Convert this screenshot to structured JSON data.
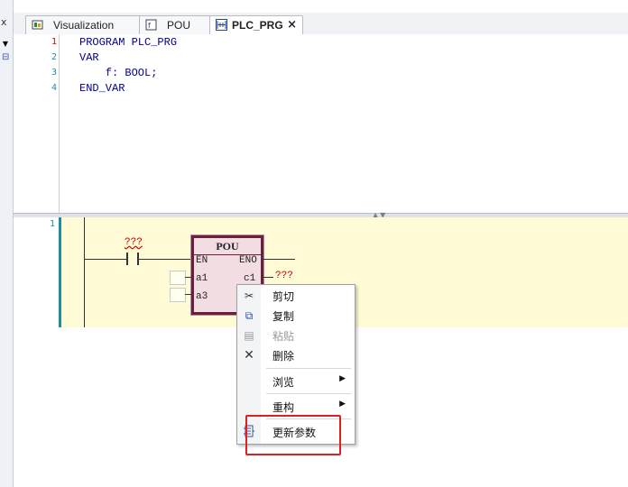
{
  "left_strip": {
    "close_glyph": "x",
    "dropdown_glyph": "▼"
  },
  "tabs": [
    {
      "label": "Visualization",
      "icon": "visualization-icon",
      "active": false
    },
    {
      "label": "POU",
      "icon": "pou-icon",
      "active": false
    },
    {
      "label": "PLC_PRG",
      "icon": "ladder-icon",
      "active": true,
      "close": "×"
    }
  ],
  "declaration": {
    "line_numbers": [
      "1",
      "2",
      "3",
      "4"
    ],
    "fold_glyph": "⊟",
    "lines": [
      "PROGRAM PLC_PRG",
      "VAR",
      "    f: BOOL;",
      "END_VAR"
    ]
  },
  "splitter_arrows": "▲▼",
  "ladder": {
    "network_number": "1",
    "contact_label": "???",
    "block": {
      "type_name": "POU",
      "input_pins": [
        "EN",
        "a1",
        "a3"
      ],
      "output_pins": [
        "ENO",
        "c1"
      ],
      "output_value": "???"
    }
  },
  "context_menu": {
    "items": [
      {
        "label": "剪切",
        "icon": "scissors-icon",
        "glyph": "✂",
        "enabled": true,
        "submenu": false
      },
      {
        "label": "复制",
        "icon": "copy-icon",
        "glyph": "⧉",
        "enabled": true,
        "submenu": false
      },
      {
        "label": "粘贴",
        "icon": "paste-icon",
        "glyph": "▤",
        "enabled": false,
        "submenu": false
      },
      {
        "label": "删除",
        "icon": "delete-icon",
        "glyph": "✕",
        "enabled": true,
        "submenu": false
      },
      {
        "label": "浏览",
        "icon": "",
        "glyph": "",
        "enabled": true,
        "submenu": true
      },
      {
        "label": "重构",
        "icon": "",
        "glyph": "",
        "enabled": true,
        "submenu": true
      },
      {
        "label": "更新参数",
        "icon": "update-parameters-icon",
        "glyph": "▦",
        "enabled": true,
        "submenu": false
      }
    ],
    "submenu_glyph": "▶",
    "highlighted_item": "更新参数",
    "highlight_color": "#e02020"
  },
  "colors": {
    "network_background": "#fffbd6",
    "block_border": "#6b1f3c",
    "error_text": "#d00000",
    "keyword_text": "#00008b"
  }
}
